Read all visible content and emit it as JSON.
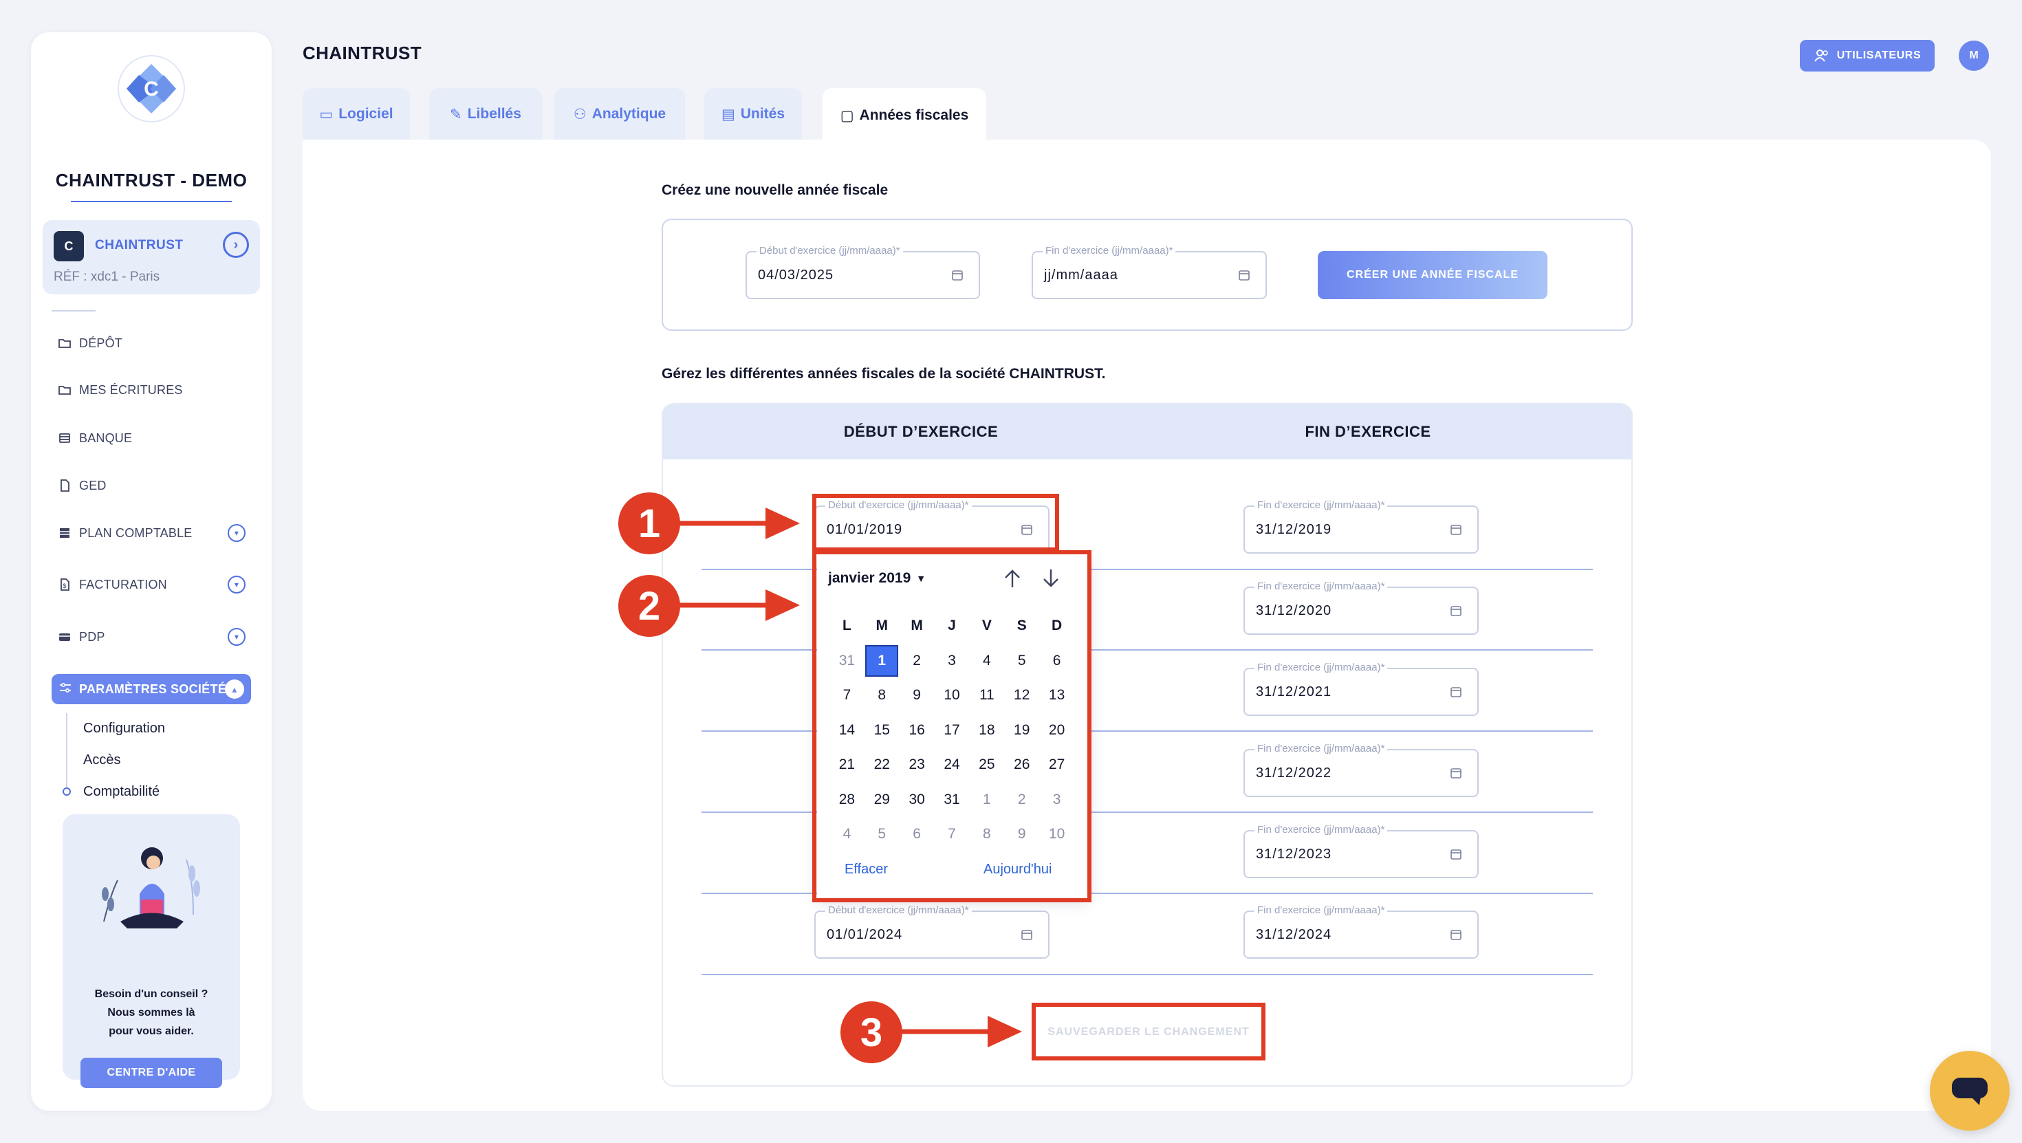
{
  "sidebar": {
    "company_title": "CHAINTRUST - DEMO",
    "company_card": {
      "logo_letter": "C",
      "name": "CHAINTRUST",
      "ref": "RÉF : xdc1 - Paris"
    },
    "items": [
      {
        "label": "DÉPÔT",
        "icon": "folder-icon",
        "has_chevron": false
      },
      {
        "label": "MES ÉCRITURES",
        "icon": "folder-icon",
        "has_chevron": false
      },
      {
        "label": "BANQUE",
        "icon": "bank-icon",
        "has_chevron": false
      },
      {
        "label": "GED",
        "icon": "document-icon",
        "has_chevron": false
      },
      {
        "label": "PLAN COMPTABLE",
        "icon": "table-icon",
        "has_chevron": true
      },
      {
        "label": "FACTURATION",
        "icon": "invoice-icon",
        "has_chevron": true
      },
      {
        "label": "PDP",
        "icon": "card-icon",
        "has_chevron": true
      }
    ],
    "active_item": {
      "label": "PARAMÈTRES SOCIÉTÉ",
      "icon": "sliders-icon"
    },
    "sub_items": [
      "Configuration",
      "Accès",
      "Comptabilité"
    ],
    "help": {
      "line1": "Besoin d'un conseil ?",
      "line2": "Nous sommes là",
      "line3": "pour vous aider.",
      "button": "CENTRE D'AIDE"
    }
  },
  "header": {
    "title": "CHAINTRUST",
    "users_button": "UTILISATEURS",
    "avatar_letter": "M"
  },
  "tabs": [
    {
      "label": "Logiciel",
      "icon": "monitor-icon"
    },
    {
      "label": "Libellés",
      "icon": "pencil-icon"
    },
    {
      "label": "Analytique",
      "icon": "users-icon"
    },
    {
      "label": "Unités",
      "icon": "box-icon"
    },
    {
      "label": "Années fiscales",
      "icon": "calendar-icon",
      "active": true
    }
  ],
  "create": {
    "heading": "Créez une nouvelle année fiscale",
    "start_label": "Début d'exercice (jj/mm/aaaa)*",
    "start_value": "04/03/2025",
    "end_label": "Fin d'exercice (jj/mm/aaaa)*",
    "end_placeholder": "jj/mm/aaaa",
    "button": "CRÉER UNE ANNÉE FISCALE"
  },
  "manage": {
    "heading": "Gérez les différentes années fiscales de la société CHAINTRUST.",
    "col_start": "DÉBUT D’EXERCICE",
    "col_end": "FIN D’EXERCICE",
    "start_label": "Début d'exercice (jj/mm/aaaa)*",
    "end_label": "Fin d'exercice (jj/mm/aaaa)*",
    "rows": [
      {
        "start": "01/01/2019",
        "end": "31/12/2019"
      },
      {
        "start": "",
        "end": "31/12/2020"
      },
      {
        "start": "",
        "end": "31/12/2021"
      },
      {
        "start": "",
        "end": "31/12/2022"
      },
      {
        "start": "",
        "end": "31/12/2023"
      },
      {
        "start": "01/01/2024",
        "end": "31/12/2024"
      }
    ],
    "save_button": "SAUVEGARDER LE CHANGEMENT"
  },
  "datepicker": {
    "month_label": "janvier 2019",
    "weekdays": [
      "L",
      "M",
      "M",
      "J",
      "V",
      "S",
      "D"
    ],
    "weeks": [
      [
        {
          "d": "31",
          "o": true
        },
        {
          "d": "1",
          "s": true
        },
        {
          "d": "2"
        },
        {
          "d": "3"
        },
        {
          "d": "4"
        },
        {
          "d": "5"
        },
        {
          "d": "6"
        }
      ],
      [
        {
          "d": "7"
        },
        {
          "d": "8"
        },
        {
          "d": "9"
        },
        {
          "d": "10"
        },
        {
          "d": "11"
        },
        {
          "d": "12"
        },
        {
          "d": "13"
        }
      ],
      [
        {
          "d": "14"
        },
        {
          "d": "15"
        },
        {
          "d": "16"
        },
        {
          "d": "17"
        },
        {
          "d": "18"
        },
        {
          "d": "19"
        },
        {
          "d": "20"
        }
      ],
      [
        {
          "d": "21"
        },
        {
          "d": "22"
        },
        {
          "d": "23"
        },
        {
          "d": "24"
        },
        {
          "d": "25"
        },
        {
          "d": "26"
        },
        {
          "d": "27"
        }
      ],
      [
        {
          "d": "28"
        },
        {
          "d": "29"
        },
        {
          "d": "30"
        },
        {
          "d": "31"
        },
        {
          "d": "1",
          "o": true
        },
        {
          "d": "2",
          "o": true
        },
        {
          "d": "3",
          "o": true
        }
      ],
      [
        {
          "d": "4",
          "o": true
        },
        {
          "d": "5",
          "o": true
        },
        {
          "d": "6",
          "o": true
        },
        {
          "d": "7",
          "o": true
        },
        {
          "d": "8",
          "o": true
        },
        {
          "d": "9",
          "o": true
        },
        {
          "d": "10",
          "o": true
        }
      ]
    ],
    "clear": "Effacer",
    "today": "Aujourd'hui"
  },
  "annotations": [
    "1",
    "2",
    "3"
  ],
  "colors": {
    "accent": "#6b86ee",
    "annotation": "#e03b24",
    "chat": "#f2bb4a"
  }
}
